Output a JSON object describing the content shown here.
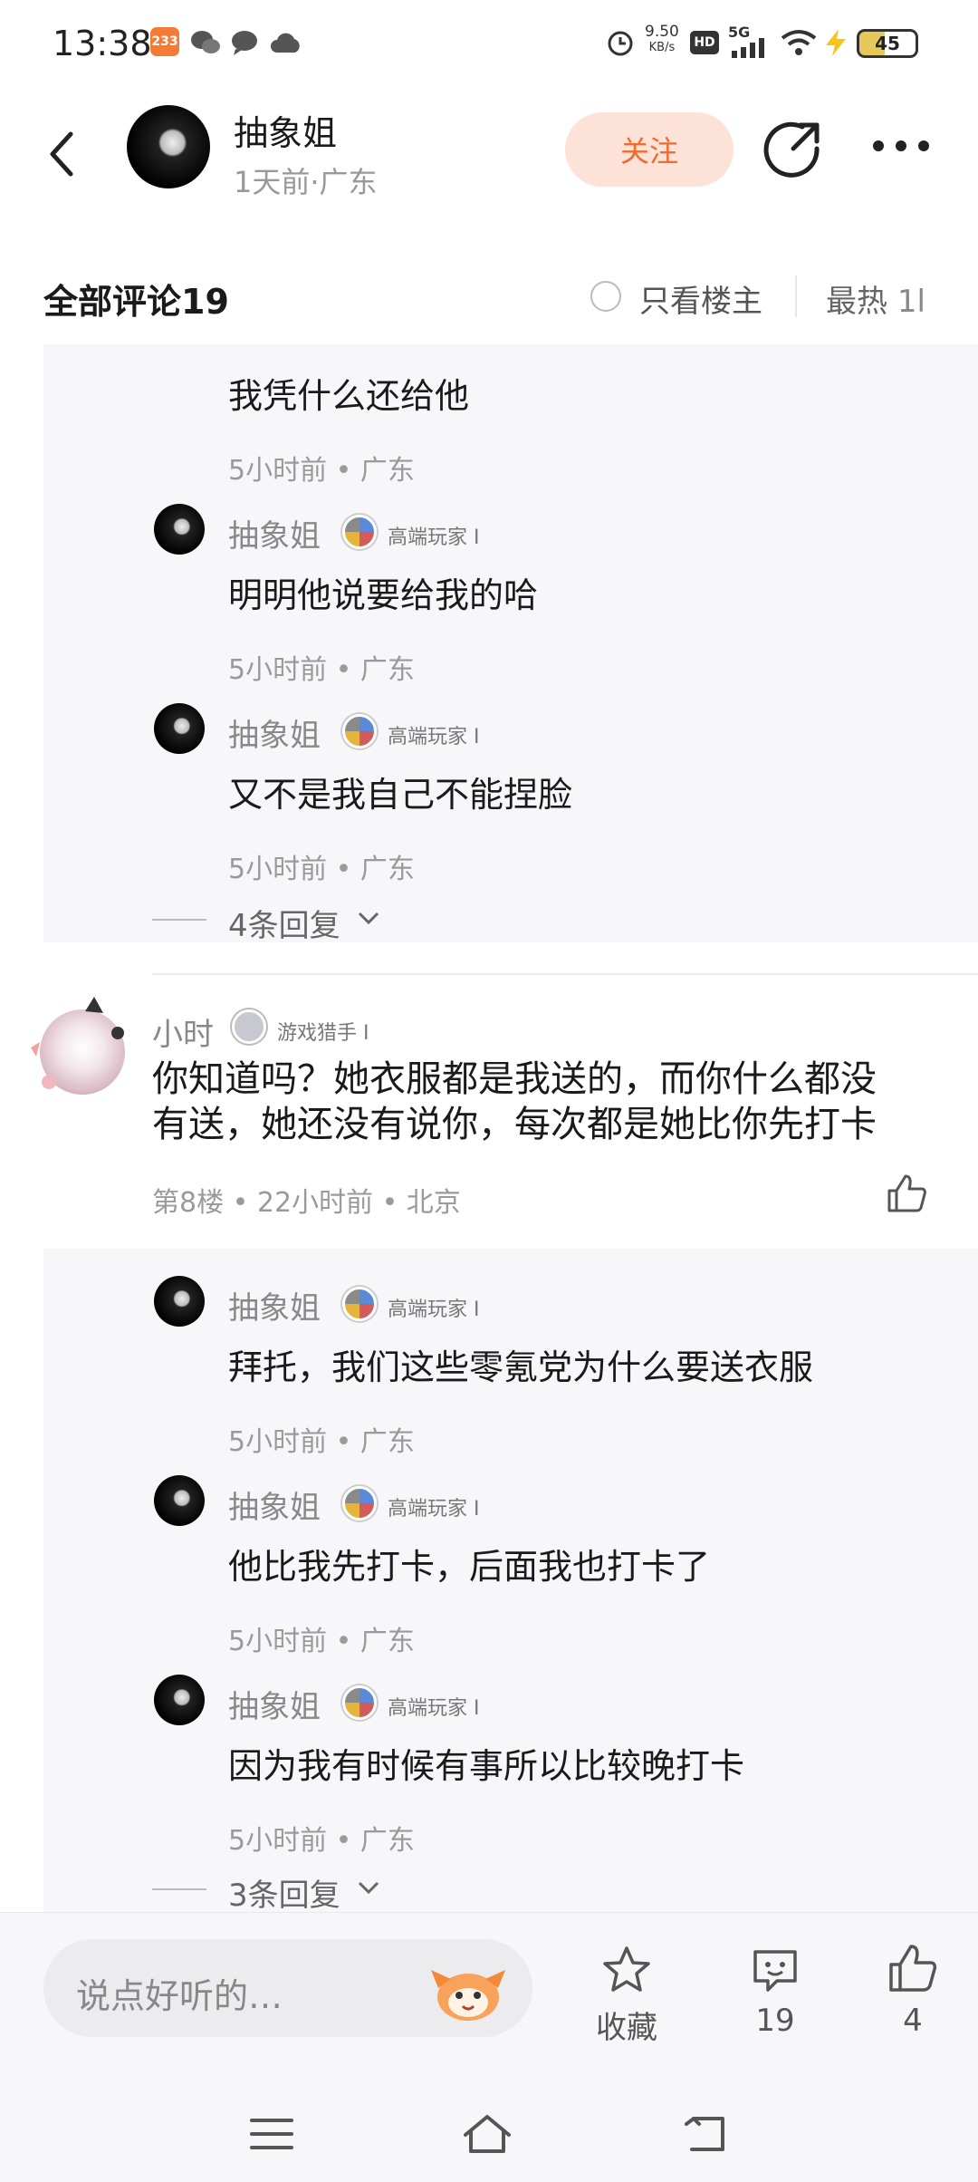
{
  "status_bar": {
    "time": "13:38",
    "app_badge": "233",
    "net_speed_top": "9.50",
    "net_speed_bottom": "KB/s",
    "hd": "HD",
    "signal": "5G",
    "battery": "45",
    "icons": [
      "wechat-icon",
      "chat-icon",
      "cloud-icon",
      "alarm-icon",
      "wifi-icon",
      "charging-icon"
    ]
  },
  "header": {
    "name": "抽象姐",
    "sub": "1天前·广东",
    "follow_label": "关注",
    "icons": [
      "back-icon",
      "share-icon",
      "more-icon"
    ]
  },
  "comments_header": {
    "title": "全部评论19",
    "only_op_label": "只看楼主",
    "sort_label": "最热",
    "sort_icon_text": "1l"
  },
  "reply_group_1": {
    "first_text": "我凭什么还给他",
    "first_meta": "5小时前 • 广东",
    "replies": [
      {
        "name": "抽象姐",
        "badge": "高端玩家 I",
        "text": "明明他说要给我的哈",
        "meta": "5小时前 • 广东"
      },
      {
        "name": "抽象姐",
        "badge": "高端玩家 I",
        "text": "又不是我自己不能捏脸",
        "meta": "5小时前 • 广东"
      }
    ],
    "more_label": "4条回复"
  },
  "comment": {
    "name": "小时",
    "badge": "游戏猎手 I",
    "text_line1": "你知道吗？她衣服都是我送的，而你什么都没",
    "text_line2": "有送，她还没有说你，每次都是她比你先打卡",
    "meta": "第8楼 • 22小时前 • 北京"
  },
  "reply_group_2": {
    "replies": [
      {
        "name": "抽象姐",
        "badge": "高端玩家 I",
        "text": "拜托，我们这些零氪党为什么要送衣服",
        "meta": "5小时前 • 广东"
      },
      {
        "name": "抽象姐",
        "badge": "高端玩家 I",
        "text": "他比我先打卡，后面我也打卡了",
        "meta": "5小时前 • 广东"
      },
      {
        "name": "抽象姐",
        "badge": "高端玩家 I",
        "text": "因为我有时候有事所以比较晚打卡",
        "meta": "5小时前 • 广东"
      }
    ],
    "more_label": "3条回复"
  },
  "bottom_bar": {
    "input_placeholder": "说点好听的…",
    "collect_label": "收藏",
    "comment_count": "19",
    "like_count": "4"
  },
  "colors": {
    "accent": "#f26a2c",
    "follow_bg": "#fde3d7",
    "reply_bg": "#f7f7f9"
  }
}
